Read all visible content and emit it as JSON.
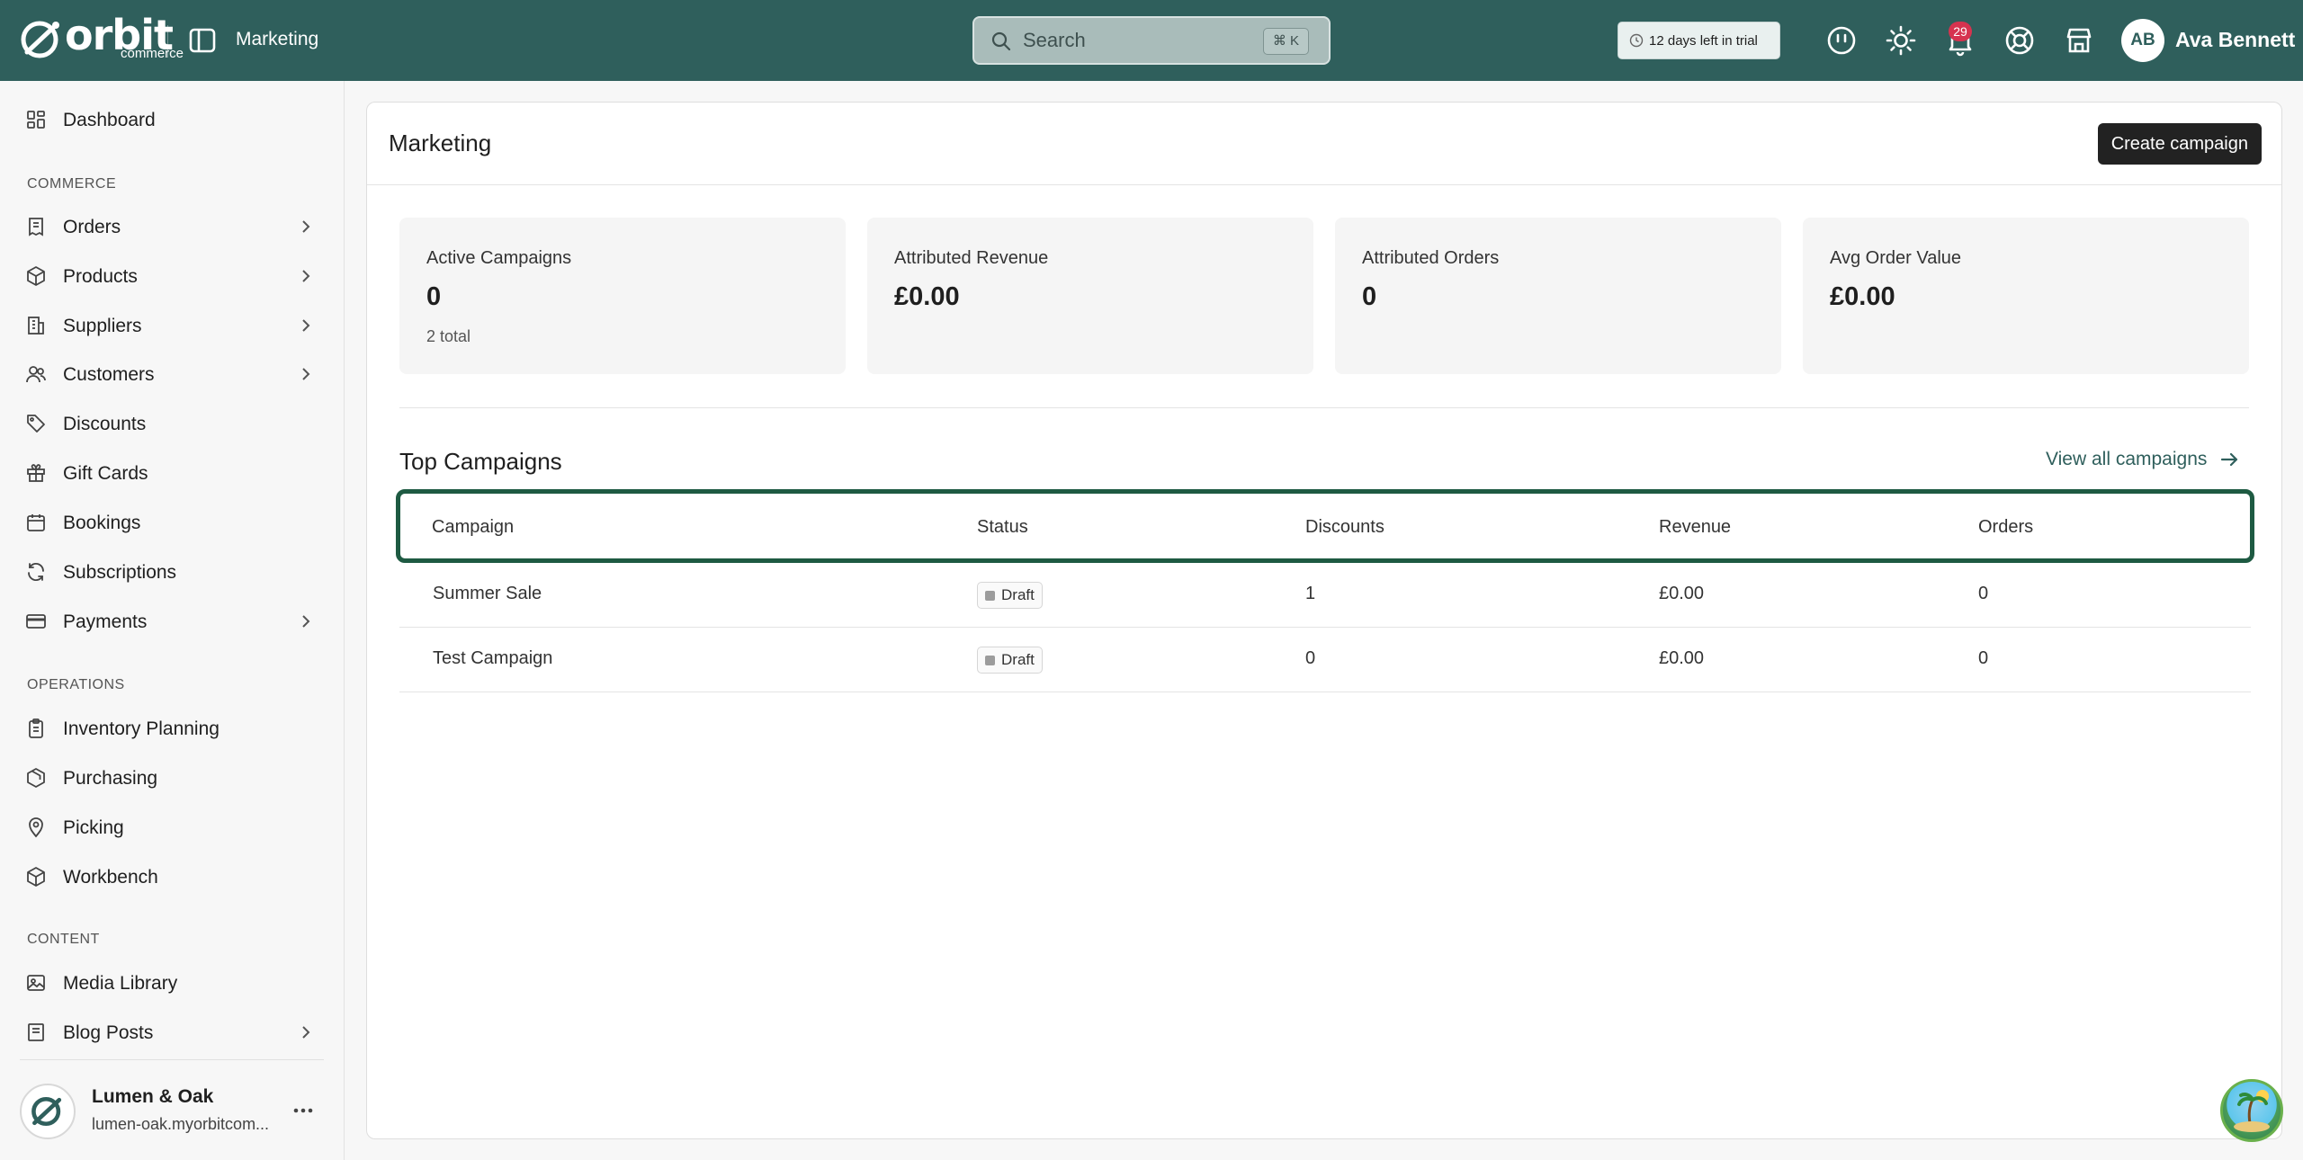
{
  "header": {
    "logo_text": "orbit",
    "logo_sub": "commerce",
    "section_title": "Marketing",
    "search_placeholder": "Search",
    "search_shortcut": "⌘ K",
    "trial_text": "12 days left in trial",
    "notifications_count": "29",
    "user_initials": "AB",
    "user_name": "Ava Bennett"
  },
  "sidebar": {
    "items": [
      {
        "label": "Dashboard",
        "icon": "dashboard-icon"
      },
      {
        "label": "Orders",
        "icon": "orders-icon",
        "has_children": true
      },
      {
        "label": "Products",
        "icon": "box-icon",
        "has_children": true
      },
      {
        "label": "Suppliers",
        "icon": "building-icon",
        "has_children": true
      },
      {
        "label": "Customers",
        "icon": "users-icon",
        "has_children": true
      },
      {
        "label": "Discounts",
        "icon": "tag-icon"
      },
      {
        "label": "Gift Cards",
        "icon": "gift-icon"
      },
      {
        "label": "Bookings",
        "icon": "calendar-icon"
      },
      {
        "label": "Subscriptions",
        "icon": "refresh-icon"
      },
      {
        "label": "Payments",
        "icon": "credit-card-icon",
        "has_children": true
      },
      {
        "label": "Inventory Planning",
        "icon": "clipboard-icon"
      },
      {
        "label": "Purchasing",
        "icon": "package-icon"
      },
      {
        "label": "Picking",
        "icon": "map-pin-icon"
      },
      {
        "label": "Workbench",
        "icon": "cube-icon"
      },
      {
        "label": "Media Library",
        "icon": "image-icon"
      },
      {
        "label": "Blog Posts",
        "icon": "document-icon",
        "has_children": true
      }
    ],
    "sections": {
      "commerce": "COMMERCE",
      "operations": "OPERATIONS",
      "content": "CONTENT"
    },
    "store": {
      "name": "Lumen & Oak",
      "domain": "lumen-oak.myorbitcom..."
    }
  },
  "main": {
    "title": "Marketing",
    "create_button": "Create campaign",
    "stats": [
      {
        "label": "Active Campaigns",
        "value": "0",
        "sub": "2 total"
      },
      {
        "label": "Attributed Revenue",
        "value": "£0.00",
        "sub": ""
      },
      {
        "label": "Attributed Orders",
        "value": "0",
        "sub": ""
      },
      {
        "label": "Avg Order Value",
        "value": "£0.00",
        "sub": ""
      }
    ],
    "top_campaigns": {
      "title": "Top Campaigns",
      "view_all": "View all campaigns",
      "columns": [
        "Campaign",
        "Status",
        "Discounts",
        "Revenue",
        "Orders"
      ],
      "rows": [
        {
          "campaign": "Summer Sale",
          "status": "Draft",
          "discounts": "1",
          "revenue": "£0.00",
          "orders": "0"
        },
        {
          "campaign": "Test Campaign",
          "status": "Draft",
          "discounts": "0",
          "revenue": "£0.00",
          "orders": "0"
        }
      ]
    }
  },
  "colors": {
    "header_bg": "#2f5f5c",
    "accent": "#2f5f5c",
    "highlight_border": "#1e5a42",
    "badge": "#d6334f"
  }
}
